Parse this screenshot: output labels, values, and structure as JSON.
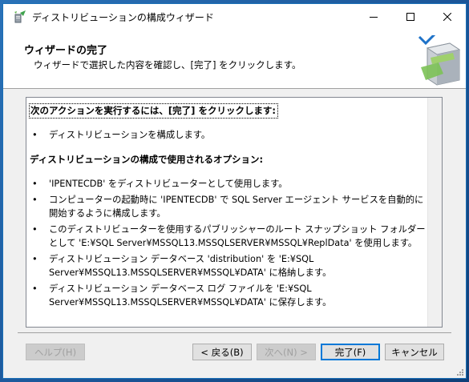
{
  "window": {
    "title": "ディストリビューションの構成ウィザード"
  },
  "header": {
    "title": "ウィザードの完了",
    "subtitle": "ウィザードで選択した内容を確認し、[完了] をクリックします。"
  },
  "summary": {
    "heading1": "次のアクションを実行するには、[完了] をクリックします:",
    "action_items": [
      "ディストリビューションを構成します。"
    ],
    "heading2": "ディストリビューションの構成で使用されるオプション:",
    "option_items": [
      "'IPENTECDB' をディストリビューターとして使用します。",
      "コンピューターの起動時に 'IPENTECDB' で SQL Server エージェント サービスを自動的に開始するように構成します。",
      "このディストリビューターを使用するパブリッシャーのルート スナップショット フォルダーとして 'E:¥SQL Server¥MSSQL13.MSSQLSERVER¥MSSQL¥ReplData' を使用します。",
      "ディストリビューション データベース 'distribution' を 'E:¥SQL Server¥MSSQL13.MSSQLSERVER¥MSSQL¥DATA' に格納します。",
      "ディストリビューション データベース ログ ファイルを 'E:¥SQL Server¥MSSQL13.MSSQLSERVER¥MSSQL¥DATA' に保存します。"
    ]
  },
  "buttons": {
    "help": "ヘルプ(H)",
    "back": "< 戻る(B)",
    "next": "次へ(N) >",
    "finish": "完了(F)",
    "cancel": "キャンセル"
  },
  "icons": {
    "app": "wizard-app-icon",
    "minimize": "minimize-icon",
    "maximize": "maximize-icon",
    "close": "close-icon",
    "header_art": "server-checkmark-icon",
    "grip": "resize-grip-icon"
  },
  "colors": {
    "accent": "#0078d7",
    "window_border": "#1a6fb6",
    "dialog_bg": "#f0f0f0"
  }
}
